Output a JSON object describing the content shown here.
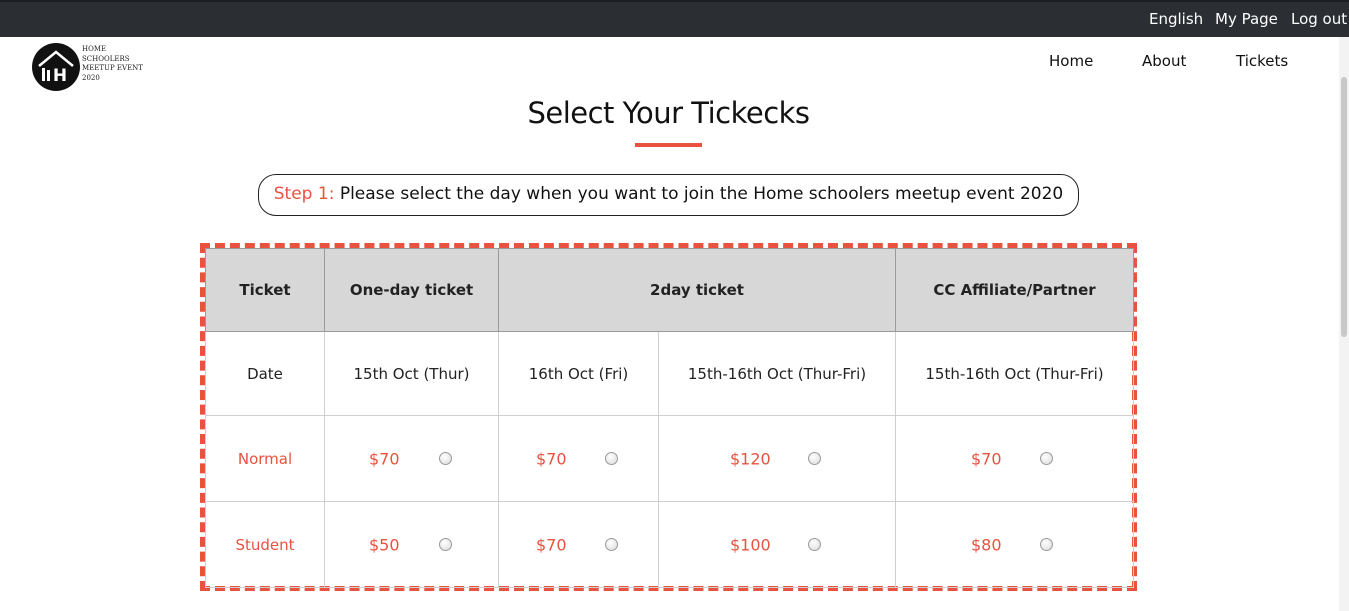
{
  "topbar": {
    "language": "English",
    "my_page": "My Page",
    "logout": "Log out"
  },
  "logo": {
    "line1": "HOME",
    "line2": "SCHOOLERS",
    "line3": "MEETUP EVENT",
    "line4": "2020",
    "mark": "H"
  },
  "nav": {
    "home": "Home",
    "about": "About",
    "tickets": "Tickets"
  },
  "page": {
    "title": "Select Your Tickecks"
  },
  "step": {
    "label": "Step 1:",
    "text": " Please select the day when you want to join the Home schoolers meetup event 2020"
  },
  "table": {
    "headers": [
      "Ticket",
      "One-day ticket",
      "2day ticket",
      "CC Affiliate/Partner"
    ],
    "date_row": [
      "Date",
      "15th Oct (Thur)",
      "16th Oct (Fri)",
      "15th-16th Oct (Thur-Fri)",
      "15th-16th Oct (Thur-Fri)"
    ],
    "normal": [
      "Normal",
      "$70",
      "$70",
      "$120",
      "$70"
    ],
    "student": [
      "Student",
      "$50",
      "$70",
      "$100",
      "$80"
    ]
  },
  "colors": {
    "accent": "#e8523f",
    "topbar": "#2b2f34",
    "header_bg": "#d7d7d7"
  }
}
